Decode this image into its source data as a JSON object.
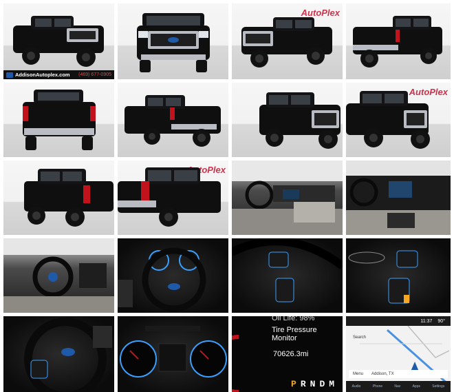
{
  "gallery": {
    "watermark": "AutoPlex",
    "dealer": {
      "site": "AddisonAutoplex.com",
      "phone": "(469) 677-0905"
    },
    "photos": [
      {
        "name": "photo-front-left-three-quarter-with-banner",
        "icon": "truck-icon"
      },
      {
        "name": "photo-front",
        "icon": "truck-icon"
      },
      {
        "name": "photo-front-right-three-quarter",
        "icon": "truck-icon"
      },
      {
        "name": "photo-rear-left-three-quarter",
        "icon": "truck-icon"
      },
      {
        "name": "photo-rear",
        "icon": "truck-icon"
      },
      {
        "name": "photo-rear-right-three-quarter",
        "icon": "truck-icon"
      },
      {
        "name": "photo-right-side-front",
        "icon": "truck-icon"
      },
      {
        "name": "photo-right-side-close",
        "icon": "truck-icon"
      },
      {
        "name": "photo-left-rear",
        "icon": "truck-icon"
      },
      {
        "name": "photo-left-rear-close",
        "icon": "truck-icon"
      },
      {
        "name": "photo-interior-passenger-view",
        "icon": "seat-icon"
      },
      {
        "name": "photo-interior-dashboard",
        "icon": "dashboard-icon"
      },
      {
        "name": "photo-interior-driver-view",
        "icon": "steering-wheel-icon"
      },
      {
        "name": "photo-steering-wheel-front",
        "icon": "steering-wheel-icon"
      },
      {
        "name": "photo-steering-controls-left",
        "icon": "button-panel-icon"
      },
      {
        "name": "photo-steering-controls-right",
        "icon": "button-panel-icon"
      },
      {
        "name": "photo-steering-wheel-close",
        "icon": "steering-wheel-icon"
      },
      {
        "name": "photo-instrument-cluster",
        "icon": "gauge-icon"
      },
      {
        "name": "photo-cluster-display",
        "icon": "gauge-icon"
      },
      {
        "name": "photo-navigation-screen",
        "icon": "map-icon"
      }
    ],
    "cluster_display": {
      "oil_life": "Oil Life: 98%",
      "message": "Tire Pressure Monitor",
      "odometer": "70626.3mi",
      "gears": [
        "P",
        "R",
        "N",
        "D",
        "M"
      ],
      "active_gear": "P"
    },
    "nav_screen": {
      "time": "11:37",
      "temp": "90°",
      "search": "Search",
      "location": "Addison, TX",
      "menu": "Menu",
      "tabs": [
        "Audio",
        "Phone",
        "Nav",
        "Apps",
        "Settings"
      ]
    },
    "colors": {
      "truck_black": "#0f0f10",
      "chrome": "#b9bcc2",
      "tail_red": "#c2121b",
      "watermark_red": "#c8102e",
      "ambient_blue": "#3aa0ff",
      "gear_amber": "#f5a623"
    }
  }
}
